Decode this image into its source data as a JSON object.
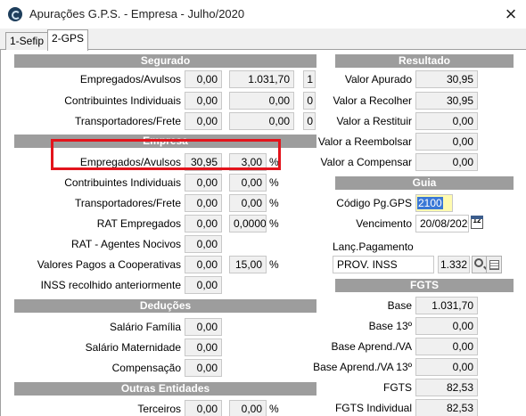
{
  "window": {
    "title": "Apurações G.P.S. - Empresa - Julho/2020",
    "close": "×"
  },
  "tabs": [
    {
      "label": "1-Sefip"
    },
    {
      "label": "2-GPS"
    }
  ],
  "segurado": {
    "header": "Segurado",
    "rows": [
      {
        "label": "Empregados/Avulsos",
        "v1": "0,00",
        "v2": "1.031,70",
        "v3": "1"
      },
      {
        "label": "Contribuintes Individuais",
        "v1": "0,00",
        "v2": "0,00",
        "v3": "0"
      },
      {
        "label": "Transportadores/Frete",
        "v1": "0,00",
        "v2": "0,00",
        "v3": "0"
      }
    ]
  },
  "empresa": {
    "header": "Empresa",
    "rows": [
      {
        "label": "Empregados/Avulsos",
        "v1": "30,95",
        "v2": "3,00",
        "unit": "%"
      },
      {
        "label": "Contribuintes Individuais",
        "v1": "0,00",
        "v2": "0,00",
        "unit": "%"
      },
      {
        "label": "Transportadores/Frete",
        "v1": "0,00",
        "v2": "0,00",
        "unit": "%"
      },
      {
        "label": "RAT Empregados",
        "v1": "0,00",
        "v2": "0,0000",
        "unit": "%"
      },
      {
        "label": "RAT - Agentes Nocivos",
        "v1": "0,00"
      },
      {
        "label": "Valores Pagos a Cooperativas",
        "v1": "0,00",
        "v2": "15,00",
        "unit": "%"
      },
      {
        "label": "INSS recolhido anteriormente",
        "v1": "0,00"
      }
    ]
  },
  "deducoes": {
    "header": "Deduções",
    "rows": [
      {
        "label": "Salário Família",
        "v1": "0,00"
      },
      {
        "label": "Salário Maternidade",
        "v1": "0,00"
      },
      {
        "label": "Compensação",
        "v1": "0,00"
      }
    ]
  },
  "outras": {
    "header": "Outras Entidades",
    "rows": [
      {
        "label": "Terceiros",
        "v1": "0,00",
        "v2": "0,00",
        "unit": "%"
      }
    ]
  },
  "resultado": {
    "header": "Resultado",
    "rows": [
      {
        "label": "Valor Apurado",
        "value": "30,95"
      },
      {
        "label": "Valor a Recolher",
        "value": "30,95"
      },
      {
        "label": "Valor a Restituir",
        "value": "0,00"
      },
      {
        "label": "Valor a Reembolsar",
        "value": "0,00"
      },
      {
        "label": "Valor a Compensar",
        "value": "0,00"
      }
    ]
  },
  "guia": {
    "header": "Guia",
    "codigo_label": "Código Pg.GPS",
    "codigo_value": "2100",
    "vencimento_label": "Vencimento",
    "vencimento_value": "20/08/2020",
    "calendar_day": "12",
    "lanc_label": "Lanç.Pagamento",
    "lanc_value": "PROV. INSS",
    "lanc_code": "1.332"
  },
  "fgts": {
    "header": "FGTS",
    "rows": [
      {
        "label": "Base",
        "value": "1.031,70"
      },
      {
        "label": "Base 13º",
        "value": "0,00"
      },
      {
        "label": "Base Aprend./VA",
        "value": "0,00"
      },
      {
        "label": "Base Aprend./VA 13º",
        "value": "0,00"
      },
      {
        "label": "FGTS",
        "value": "82,53"
      },
      {
        "label": "FGTS Individual",
        "value": "82,53"
      }
    ]
  }
}
